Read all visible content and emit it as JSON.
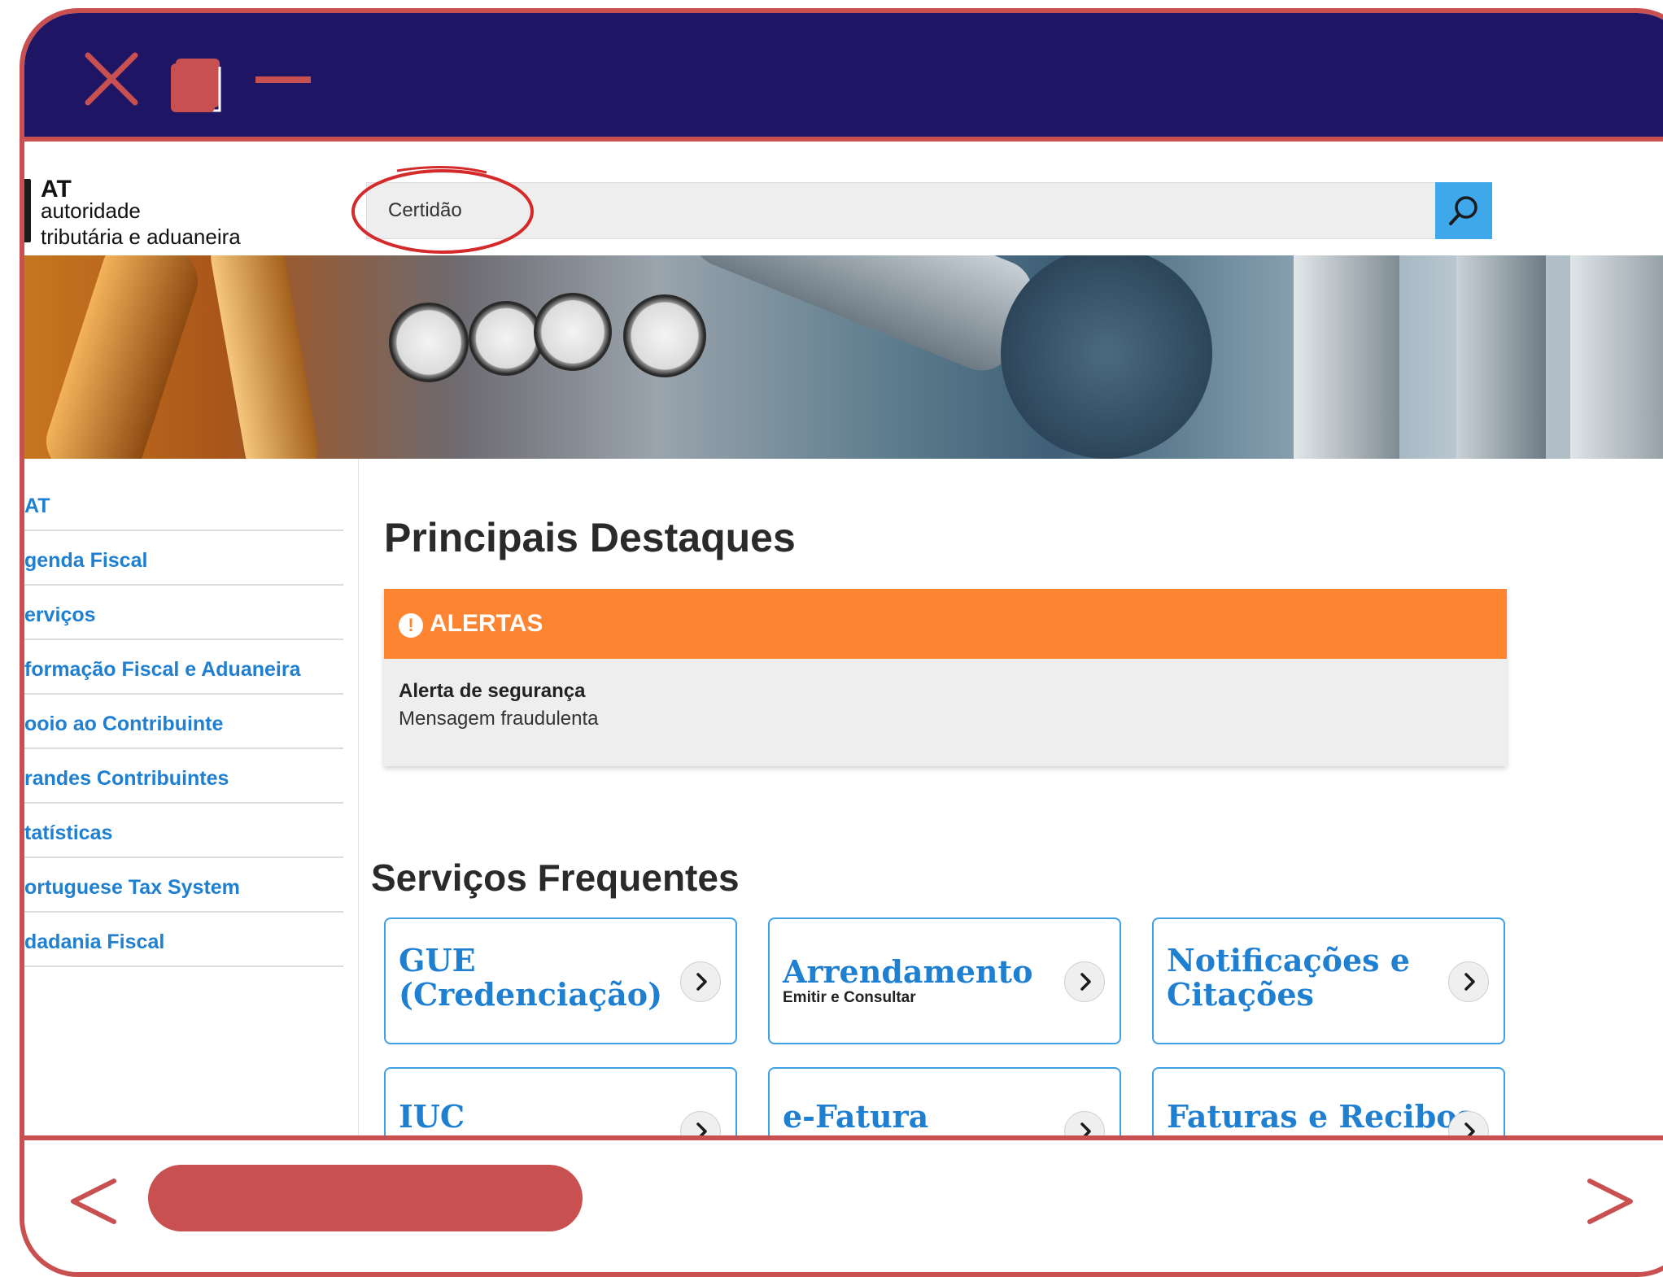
{
  "site": {
    "logo_short": "AT",
    "logo_line1": "autoridade",
    "logo_line2": "tributária e aduaneira"
  },
  "search": {
    "value": "Certidão"
  },
  "sidebar": {
    "items": [
      {
        "label": "AT"
      },
      {
        "label": "genda Fiscal"
      },
      {
        "label": "erviços"
      },
      {
        "label": "formação Fiscal e Aduaneira"
      },
      {
        "label": "ooio ao Contribuinte"
      },
      {
        "label": "randes Contribuintes"
      },
      {
        "label": "tatísticas"
      },
      {
        "label": "ortuguese Tax System"
      },
      {
        "label": "dadania Fiscal"
      }
    ]
  },
  "main": {
    "highlights_title": "Principais Destaques",
    "alerts": {
      "heading": "ALERTAS",
      "icon_glyph": "!",
      "item_title": "Alerta de segurança",
      "item_text": "Mensagem fraudulenta"
    },
    "services_title": "Serviços Frequentes",
    "services": [
      {
        "title_line1": "GUE",
        "title_line2": "(Credenciação)",
        "subtitle": ""
      },
      {
        "title_line1": "Arrendamento",
        "title_line2": "",
        "subtitle": "Emitir e Consultar"
      },
      {
        "title_line1": "Notificações e",
        "title_line2": "Citações",
        "subtitle": ""
      },
      {
        "title_line1": "IUC",
        "title_line2": "",
        "subtitle": ""
      },
      {
        "title_line1": "e-Fatura",
        "title_line2": "",
        "subtitle": ""
      },
      {
        "title_line1": "Faturas e Recibos",
        "title_line2": "",
        "subtitle": ""
      }
    ]
  },
  "icons": {
    "window": [
      "close-icon",
      "maximize-icon",
      "minimize-icon"
    ],
    "search": "search-icon",
    "card_arrow": "chevron-right-icon",
    "browser_nav": [
      "chevron-left-icon",
      "chevron-right-icon"
    ]
  },
  "colors": {
    "titlebar": "#1e1565",
    "frame_accent": "#c95050",
    "link_blue": "#1f7fd1",
    "search_button": "#3ea8ea",
    "alert_orange": "#fd8431"
  }
}
